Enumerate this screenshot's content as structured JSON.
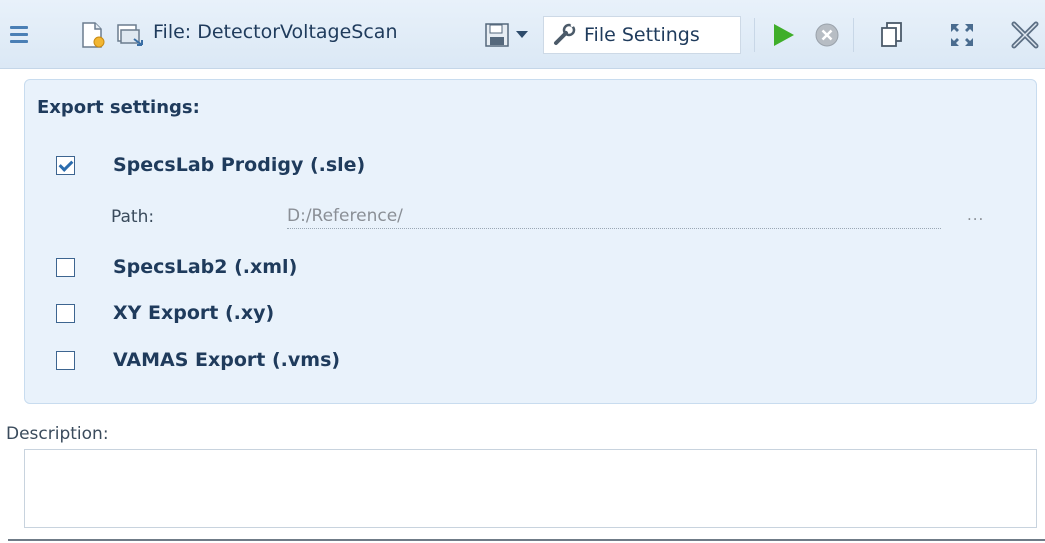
{
  "toolbar": {
    "file_label": "File: DetectorVoltageScan",
    "file_settings_label": "File Settings",
    "icons": [
      "menu-icon",
      "new-file-icon",
      "open-file-icon",
      "save-icon",
      "dropdown-arrow-icon",
      "wrench-icon",
      "play-icon",
      "stop-icon",
      "copy-icon",
      "expand-icon",
      "close-icon"
    ],
    "colors": {
      "play": "#3fae2a",
      "stop": "#b7bdc4",
      "accent": "#4a7fb5"
    }
  },
  "export": {
    "title": "Export settings:",
    "options": [
      {
        "label": "SpecsLab Prodigy (.sle)",
        "checked": true
      },
      {
        "label": "SpecsLab2 (.xml)",
        "checked": false
      },
      {
        "label": "XY Export (.xy)",
        "checked": false
      },
      {
        "label": "VAMAS Export (.vms)",
        "checked": false
      }
    ],
    "path_label": "Path:",
    "path_value": "D:/Reference/",
    "browse_label": "..."
  },
  "description": {
    "label": "Description:",
    "value": ""
  }
}
